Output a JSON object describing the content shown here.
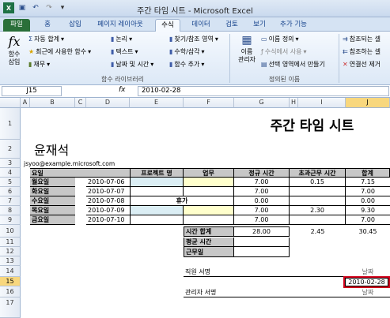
{
  "window": {
    "title": "주간 타임 시트 - Microsoft Excel"
  },
  "ribbon_tabs": [
    "파일",
    "홈",
    "삽입",
    "페이지 레이아웃",
    "수식",
    "데이터",
    "검토",
    "보기",
    "추가 기능"
  ],
  "ribbon": {
    "insert_function": "함수\n삽입",
    "autosum": "자동 합계",
    "recent": "최근에 사용한 함수",
    "financial": "재무",
    "logical": "논리",
    "text": "텍스트",
    "datetime": "날짜 및 시간",
    "lookup": "찾기/참조 영역",
    "math": "수학/삼각",
    "more_functions": "함수 추가",
    "group_library": "함수 라이브러리",
    "name_manager": "이름\n관리자",
    "define_name": "이름 정의",
    "use_in_formula": "수식에서 사용",
    "create_from_sel": "선택 영역에서 만들기",
    "group_names": "정의된 이름",
    "trace_precedents": "참조되는 셀",
    "trace_dependents": "참조하는 셀",
    "remove_arrows": "연결선 제거"
  },
  "formula_bar": {
    "name_box": "J15",
    "fx": "fx",
    "value": "2010-02-28"
  },
  "columns": [
    "A",
    "B",
    "C",
    "D",
    "E",
    "F",
    "G",
    "H",
    "I",
    "J"
  ],
  "rows": [
    "1",
    "2",
    "3",
    "4",
    "5",
    "6",
    "7",
    "8",
    "9",
    "10",
    "11",
    "12",
    "13",
    "14",
    "15",
    "16",
    "17"
  ],
  "sheet": {
    "title": "주간 타임 시트",
    "name": "윤재석",
    "email": "jsyoo@example.microsoft.com",
    "headers": {
      "day": "요일",
      "project": "프로젝트 명",
      "task": "업무",
      "regular": "정규 시간",
      "overtime": "초과근무 시간",
      "total": "합계"
    },
    "days": [
      {
        "day": "월요일",
        "date": "2010-07-06",
        "regular": "7.00",
        "overtime": "0.15",
        "total": "7.15"
      },
      {
        "day": "화요일",
        "date": "2010-07-07",
        "regular": "7.00",
        "overtime": "",
        "total": "7.00"
      },
      {
        "day": "수요일",
        "date": "2010-07-08",
        "regular": "0.00",
        "overtime": "",
        "total": "0.00"
      },
      {
        "day": "목요일",
        "date": "2010-07-09",
        "regular": "7.00",
        "overtime": "2.30",
        "total": "9.30"
      },
      {
        "day": "금요일",
        "date": "2010-07-10",
        "regular": "7.00",
        "overtime": "",
        "total": "7.00"
      }
    ],
    "holiday": "휴가",
    "time_total_label": "시간 합계",
    "time_total_regular": "28.00",
    "time_total_overtime": "2.45",
    "time_total_total": "30.45",
    "avg_label": "평균 시간",
    "workdays_label": "근무일",
    "employee_sign": "직원 서명",
    "date_label": "날짜",
    "date_value": "2010-02-28",
    "manager_sign": "관리자 서명",
    "date_label2": "날짜"
  }
}
